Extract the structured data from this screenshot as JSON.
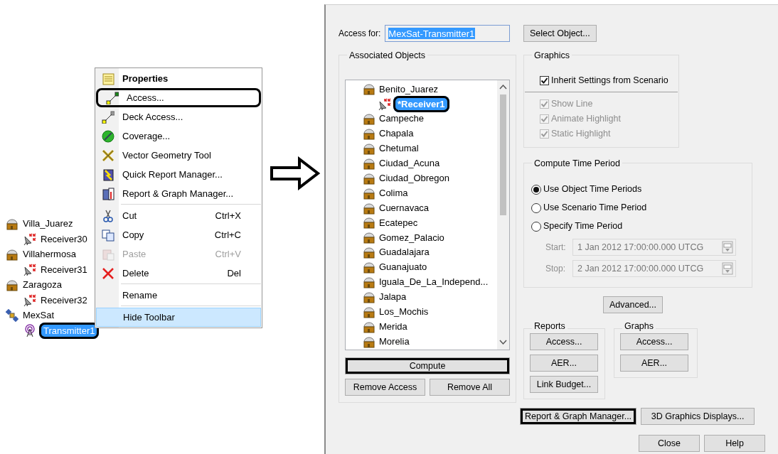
{
  "tree": [
    {
      "label": "Villa_Juarez",
      "kind": "facility",
      "selected": false,
      "annotated": false,
      "children": [
        {
          "label": "Receiver30",
          "kind": "receiver",
          "selected": false,
          "annotated": false
        }
      ]
    },
    {
      "label": "Villahermosa",
      "kind": "facility",
      "selected": false,
      "annotated": false,
      "children": [
        {
          "label": "Receiver31",
          "kind": "receiver",
          "selected": false,
          "annotated": false
        }
      ]
    },
    {
      "label": "Zaragoza",
      "kind": "facility",
      "selected": false,
      "annotated": false,
      "children": [
        {
          "label": "Receiver32",
          "kind": "receiver",
          "selected": false,
          "annotated": false
        }
      ]
    },
    {
      "label": "MexSat",
      "kind": "satellite",
      "selected": false,
      "annotated": false,
      "children": [
        {
          "label": "Transmitter1",
          "kind": "transmitter",
          "selected": true,
          "annotated": true
        }
      ]
    }
  ],
  "context_menu": [
    {
      "kind": "default",
      "label": "Properties",
      "disabled": false,
      "highlighted": false,
      "annotated": false
    },
    {
      "kind": "item",
      "label": "Access...",
      "disabled": false,
      "highlighted": false,
      "annotated": true
    },
    {
      "kind": "item",
      "label": "Deck Access...",
      "disabled": false,
      "highlighted": false,
      "annotated": false
    },
    {
      "kind": "item",
      "label": "Coverage...",
      "disabled": false,
      "highlighted": false,
      "annotated": false
    },
    {
      "kind": "item",
      "label": "Vector Geometry Tool",
      "disabled": false,
      "highlighted": false,
      "annotated": false
    },
    {
      "kind": "item",
      "label": "Quick Report Manager...",
      "disabled": false,
      "highlighted": false,
      "annotated": false
    },
    {
      "kind": "item",
      "label": "Report & Graph Manager...",
      "disabled": false,
      "highlighted": false,
      "annotated": false
    },
    {
      "kind": "separator"
    },
    {
      "kind": "item",
      "label": "Cut",
      "shortcut": "Ctrl+X",
      "disabled": false,
      "highlighted": false,
      "annotated": false
    },
    {
      "kind": "item",
      "label": "Copy",
      "shortcut": "Ctrl+C",
      "disabled": false,
      "highlighted": false,
      "annotated": false
    },
    {
      "kind": "item",
      "label": "Paste",
      "shortcut": "Ctrl+V",
      "disabled": true,
      "highlighted": false,
      "annotated": false
    },
    {
      "kind": "item",
      "label": "Delete",
      "shortcut": "Del",
      "disabled": false,
      "highlighted": false,
      "annotated": false
    },
    {
      "kind": "separator"
    },
    {
      "kind": "item",
      "label": "Rename",
      "disabled": false,
      "highlighted": false,
      "annotated": false
    },
    {
      "kind": "separator"
    },
    {
      "kind": "item",
      "label": "Hide Toolbar",
      "disabled": false,
      "highlighted": true,
      "annotated": false
    }
  ],
  "dialog": {
    "access_for": {
      "label": "Access for:",
      "value": "MexSat-Transmitter1"
    },
    "select_object_button": {
      "label": "Select Object...",
      "annotated": false
    },
    "associated_objects": {
      "title": "Associated Objects",
      "items": [
        {
          "label": "Benito_Juarez",
          "selected": false,
          "children": [
            {
              "label": "*Receiver1",
              "kind": "receiver",
              "selected": true,
              "annotated": true
            }
          ]
        },
        {
          "label": "Campeche",
          "selected": false
        },
        {
          "label": "Chapala",
          "selected": false
        },
        {
          "label": "Chetumal",
          "selected": false
        },
        {
          "label": "Ciudad_Acuna",
          "selected": false
        },
        {
          "label": "Ciudad_Obregon",
          "selected": false
        },
        {
          "label": "Colima",
          "selected": false
        },
        {
          "label": "Cuernavaca",
          "selected": false
        },
        {
          "label": "Ecatepec",
          "selected": false
        },
        {
          "label": "Gomez_Palacio",
          "selected": false
        },
        {
          "label": "Guadalajara",
          "selected": false
        },
        {
          "label": "Guanajuato",
          "selected": false
        },
        {
          "label": "Iguala_De_La_Independ...",
          "selected": false
        },
        {
          "label": "Jalapa",
          "selected": false
        },
        {
          "label": "Los_Mochis",
          "selected": false
        },
        {
          "label": "Merida",
          "selected": false
        },
        {
          "label": "Morelia",
          "selected": false
        }
      ],
      "buttons": [
        {
          "label": "Compute",
          "annotated": true
        },
        {
          "label": "Remove Access",
          "annotated": false
        },
        {
          "label": "Remove All",
          "annotated": false
        }
      ]
    },
    "graphics": {
      "title": "Graphics",
      "inherit": {
        "label": "Inherit Settings from Scenario",
        "checked": true,
        "disabled": false
      },
      "options": [
        {
          "label": "Show Line",
          "checked": true,
          "disabled": true
        },
        {
          "label": "Animate Highlight",
          "checked": true,
          "disabled": true
        },
        {
          "label": "Static Highlight",
          "checked": true,
          "disabled": true
        }
      ]
    },
    "compute_time_period": {
      "title": "Compute Time Period",
      "options": [
        {
          "label": "Use Object Time Periods",
          "selected": true
        },
        {
          "label": "Use Scenario Time Period",
          "selected": false
        },
        {
          "label": "Specify Time Period",
          "selected": false
        }
      ],
      "fields": [
        {
          "label": "Start:",
          "value": "1 Jan 2012 17:00:00.000 UTCG",
          "disabled": true
        },
        {
          "label": "Stop:",
          "value": "2 Jan 2012 17:00:00.000 UTCG",
          "disabled": true
        }
      ]
    },
    "advanced_button": {
      "label": "Advanced...",
      "annotated": false
    },
    "reports": {
      "title": "Reports",
      "buttons": [
        {
          "label": "Access...",
          "annotated": false
        },
        {
          "label": "AER...",
          "annotated": false
        },
        {
          "label": "Link Budget...",
          "annotated": false
        }
      ]
    },
    "graphs": {
      "title": "Graphs",
      "buttons": [
        {
          "label": "Access...",
          "annotated": false
        },
        {
          "label": "AER...",
          "annotated": false
        }
      ]
    },
    "manager_buttons": [
      {
        "label": "Report & Graph Manager...",
        "annotated": true
      },
      {
        "label": "3D Graphics Displays...",
        "annotated": false
      }
    ],
    "footer_buttons": [
      {
        "label": "Close",
        "annotated": false
      },
      {
        "label": "Help",
        "annotated": false
      }
    ]
  }
}
